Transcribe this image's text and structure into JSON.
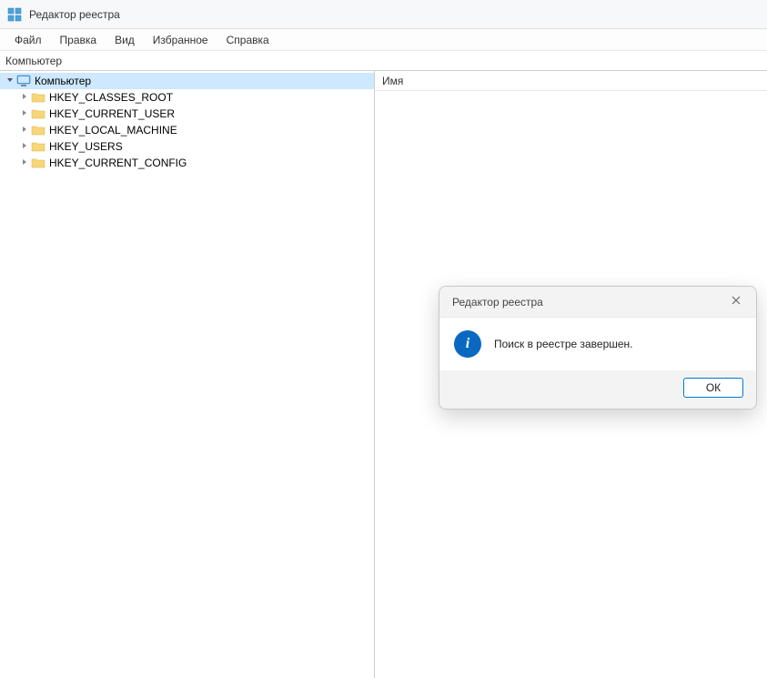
{
  "window": {
    "title": "Редактор реестра"
  },
  "menu": {
    "file": "Файл",
    "edit": "Правка",
    "view": "Вид",
    "favorites": "Избранное",
    "help": "Справка"
  },
  "addressbar": {
    "path": "Компьютер"
  },
  "tree": {
    "root": {
      "label": "Компьютер",
      "expanded": true
    },
    "children": [
      {
        "label": "HKEY_CLASSES_ROOT"
      },
      {
        "label": "HKEY_CURRENT_USER"
      },
      {
        "label": "HKEY_LOCAL_MACHINE"
      },
      {
        "label": "HKEY_USERS"
      },
      {
        "label": "HKEY_CURRENT_CONFIG"
      }
    ]
  },
  "list": {
    "header_name": "Имя"
  },
  "dialog": {
    "title": "Редактор реестра",
    "message": "Поиск в реестре завершен.",
    "ok_label": "ОК",
    "info_glyph": "i"
  }
}
